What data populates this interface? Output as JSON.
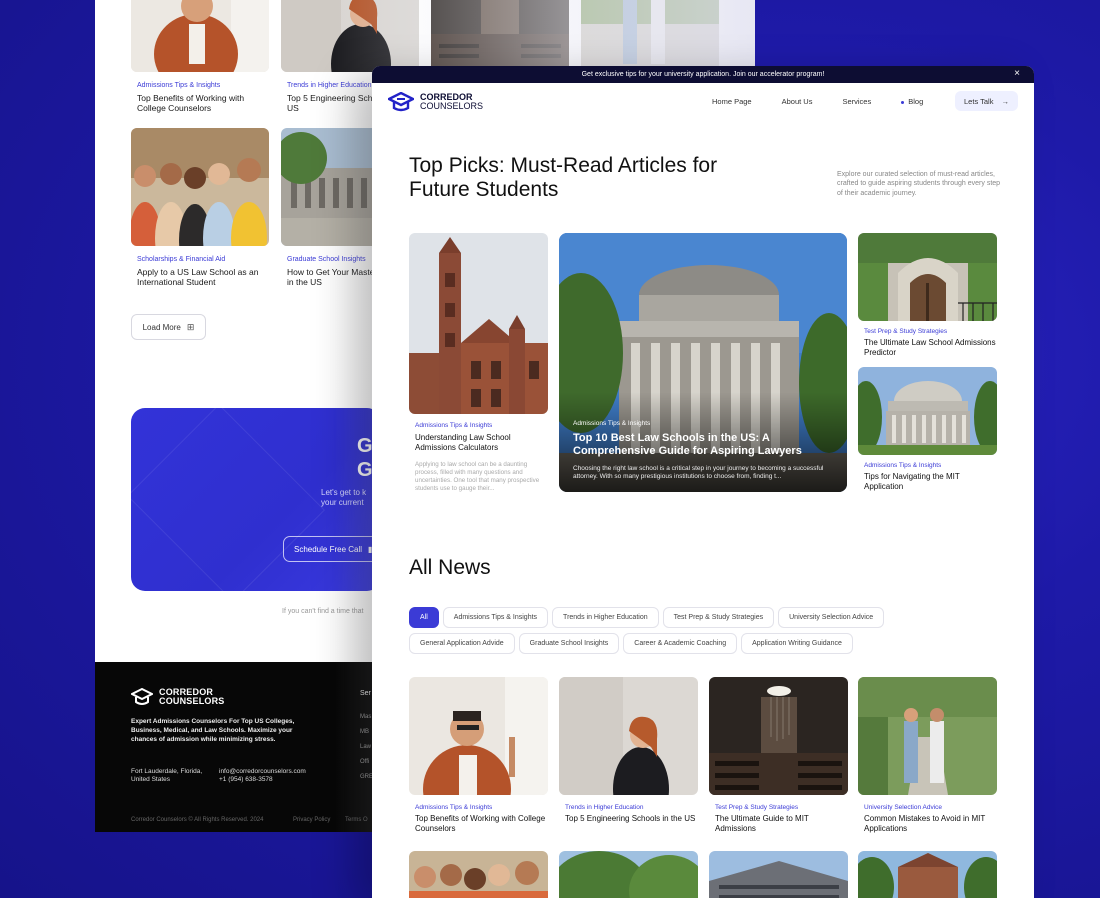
{
  "background_page": {
    "cards": [
      {
        "category": "Admissions Tips & Insights",
        "title": "Top Benefits of Working with College Counselors"
      },
      {
        "category": "Trends in Higher Education",
        "title": "Top 5 Engineering Schools in the US"
      },
      {
        "category": "Scholarships & Financial Aid",
        "title": "Apply to a US Law School as an International Student"
      },
      {
        "category": "Graduate School Insights",
        "title": "How to Get Your Master's Degree in the US"
      }
    ],
    "load_more": "Load More",
    "cta": {
      "heading_partial": "G\nGo",
      "sub_partial": "Let's get to k\nyour current",
      "button": "Schedule Free Call"
    },
    "note_partial": "If you can't find a time that",
    "footer": {
      "brand_line1": "CORREDOR",
      "brand_line2": "COUNSELORS",
      "description": "Expert Admissions Counselors For Top US Colleges, Business, Medical, and Law Schools. Maximize your chances of admission while minimizing stress.",
      "location": "Fort Lauderdale, Florida, United States",
      "email": "info@corredorcounselors.com",
      "phone": "+1 (954) 638-3578",
      "column_heading": "Ser",
      "column_items": [
        "Mas",
        "MB",
        "Law",
        "Offi",
        "GRE"
      ],
      "copyright": "Corredor Counselors © All Rights Reserved. 2024",
      "privacy": "Privacy Policy",
      "terms": "Terms O"
    }
  },
  "promo_bar": {
    "text": "Get exclusive tips for your university application.  Join our accelerator program!",
    "close": "×"
  },
  "nav": {
    "brand_line1": "CORREDOR",
    "brand_line2": "COUNSELORS",
    "links": [
      "Home Page",
      "About Us",
      "Services",
      "Blog"
    ],
    "cta": "Lets Talk",
    "cta_arrow": "→"
  },
  "hero": {
    "title": "Top Picks: Must-Read Articles for Future Students",
    "description": "Explore our curated selection of must-read articles, crafted to guide aspiring students through every step of their academic journey."
  },
  "top_picks": {
    "left": {
      "category": "Admissions Tips & Insights",
      "title": "Understanding Law School Admissions Calculators",
      "excerpt": "Applying to law school can be a daunting process, filled with many questions and uncertainties. One tool that many prospective students use to gauge their..."
    },
    "main": {
      "category": "Admissions Tips & Insights",
      "title": "Top 10 Best Law Schools in the US: A Comprehensive Guide for Aspiring Lawyers",
      "excerpt": "Choosing the right law school is a critical step in your journey to becoming a successful attorney. With so many prestigious institutions to choose from, finding t..."
    },
    "right": [
      {
        "category": "Test Prep & Study Strategies",
        "title": "The Ultimate Law School Admissions Predictor"
      },
      {
        "category": "Admissions Tips & Insights",
        "title": "Tips for Navigating the MIT Application"
      }
    ]
  },
  "all_news": {
    "heading": "All News",
    "filters": [
      "All",
      "Admissions Tips & Insights",
      "Trends in Higher Education",
      "Test Prep & Study Strategies",
      "University Selection Advice",
      "General Application Advide",
      "Graduate School Insights",
      "Career & Academic Coaching",
      "Application Writing Guidance"
    ],
    "active_filter": "All",
    "cards": [
      {
        "category": "Admissions Tips & Insights",
        "title": "Top Benefits of Working with College Counselors"
      },
      {
        "category": "Trends in Higher Education",
        "title": "Top 5 Engineering Schools in the US"
      },
      {
        "category": "Test Prep & Study Strategies",
        "title": "The Ultimate Guide to MIT Admissions"
      },
      {
        "category": "University Selection Advice",
        "title": "Common Mistakes to Avoid in MIT Applications"
      }
    ]
  },
  "colors": {
    "background": "#1e1aa8",
    "accent": "#3b3bd6",
    "promo_bar": "#0d0d33",
    "footer": "#070707"
  }
}
